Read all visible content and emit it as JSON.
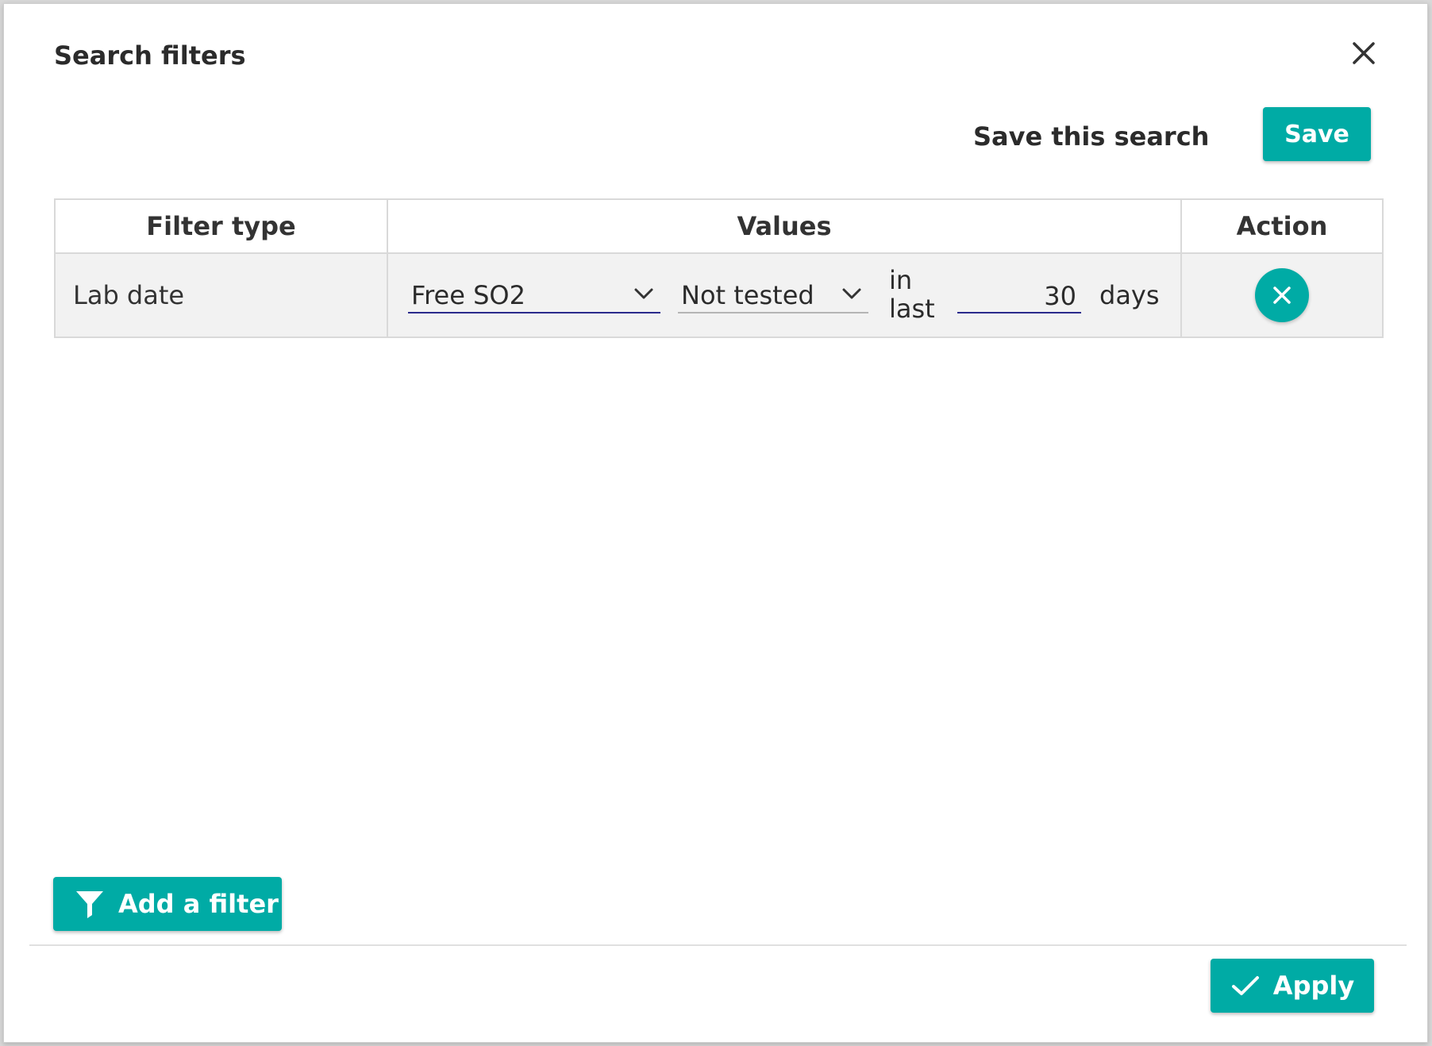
{
  "dialog": {
    "title": "Search filters"
  },
  "save_search": {
    "label": "Save this search",
    "button_label": "Save"
  },
  "table": {
    "headers": {
      "filter_type": "Filter type",
      "values": "Values",
      "action": "Action"
    },
    "rows": [
      {
        "filter_type": "Lab date",
        "analysis_select": "Free SO2",
        "status_select": "Not tested",
        "in_text": "in",
        "last_text": "last",
        "days_value": "30",
        "days_label": "days"
      }
    ]
  },
  "footer": {
    "add_filter_label": "Add a filter",
    "apply_label": "Apply"
  },
  "icons": {
    "close": "close-icon",
    "chevron": "chevron-down-icon",
    "remove": "close-icon",
    "filter": "filter-icon",
    "check": "check-icon"
  },
  "colors": {
    "accent": "#00aba5",
    "field_underline_active": "#2b2b8c",
    "row_background": "#f2f2f2",
    "border": "#d9d9d9"
  }
}
